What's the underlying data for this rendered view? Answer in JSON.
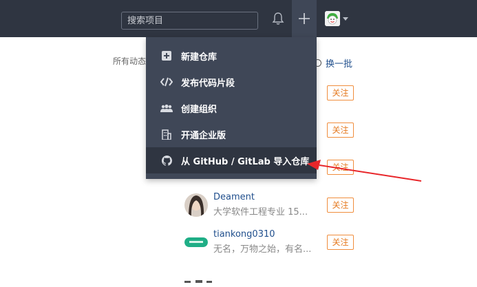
{
  "header": {
    "search_placeholder": "搜索项目",
    "icons": [
      "bell-icon",
      "plus-icon",
      "avatar-icon",
      "caret-down-icon"
    ]
  },
  "feed": {
    "activity_label": "所有动态",
    "refresh_label": "换一批",
    "follow_label": "关注",
    "users": [
      {
        "name": "Deament",
        "desc": "大学软件工程专业 15..."
      },
      {
        "name": "tiankong0310",
        "desc": "无名，万物之始，有名..."
      }
    ]
  },
  "dropdown": {
    "items": [
      {
        "label": "新建仓库",
        "icon": "plus-square-icon"
      },
      {
        "label": "发布代码片段",
        "icon": "code-icon"
      },
      {
        "label": "创建组织",
        "icon": "group-icon"
      },
      {
        "label": "开通企业版",
        "icon": "building-icon"
      },
      {
        "label": "从 GitHub / GitLab 导入仓库",
        "icon": "github-icon"
      }
    ]
  },
  "colors": {
    "topbar": "#2f3541",
    "dropdown": "#3f4757",
    "follow": "#e57a20",
    "link": "#1f4e8c",
    "annotation_arrow": "#e8262a"
  }
}
